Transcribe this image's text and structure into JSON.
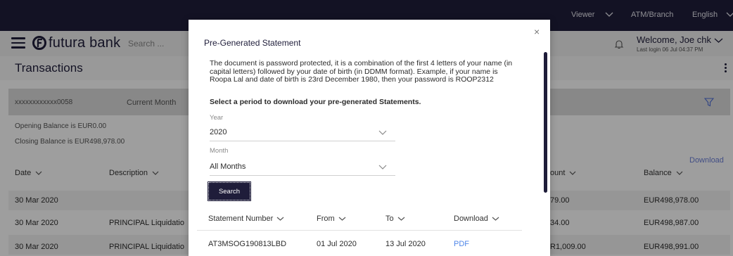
{
  "topbar": {
    "viewer_label": "Viewer",
    "atm_label": "ATM/Branch",
    "language_label": "English"
  },
  "header": {
    "logo_text": "futura bank",
    "search_placeholder": "Search ...",
    "welcome_text": "Welcome, Joe chk",
    "last_login": "Last login 06 Jul 04:37 PM"
  },
  "page": {
    "title": "Transactions"
  },
  "filters": {
    "account": "xxxxxxxxxxxx0058",
    "period": "Current Month"
  },
  "balances": {
    "opening": "Opening Balance is EUR0.00",
    "closing": "Closing Balance is EUR498,978.00"
  },
  "download_label": "Download",
  "table": {
    "headers": {
      "date": "Date",
      "description": "Description",
      "amount": "ount",
      "balance": "Balance"
    },
    "rows": [
      {
        "date": "30 Mar 2020",
        "description": "",
        "amount": "79.00",
        "balance": "EUR498,978.00"
      },
      {
        "date": "30 Mar 2020",
        "description": "PRINCIPAL Liquidatio",
        "amount": "34.00",
        "balance": "EUR498,987.00"
      },
      {
        "date": "30 Mar 2020",
        "description": "PRINCIPAL Liquidatio",
        "amount": "R1,009.00",
        "balance": "EUR498,991.00"
      }
    ]
  },
  "modal": {
    "close_icon": "×",
    "title": "Pre-Generated Statement",
    "info": "The document is password protected, it is a combination of the first 4 letters of your name (in capital letters) followed by your date of birth (in DDMM format). Example, if your name is Roopa Lal and date of birth is 23rd December 1980, then your password is ROOP2312",
    "instruction": "Select a period to download your pre-generated Statements.",
    "year_label": "Year",
    "year_value": "2020",
    "month_label": "Month",
    "month_value": "All Months",
    "search_button": "Search",
    "headers": {
      "statement_number": "Statement Number",
      "from": "From",
      "to": "To",
      "download": "Download"
    },
    "rows": [
      {
        "statement_number": "AT3MSOG190813LBD",
        "from": "01 Jul 2020",
        "to": "13 Jul 2020",
        "download": "PDF"
      }
    ]
  },
  "colors": {
    "brand_dark": "#1f1d3a",
    "link_blue": "#4f86e8"
  }
}
